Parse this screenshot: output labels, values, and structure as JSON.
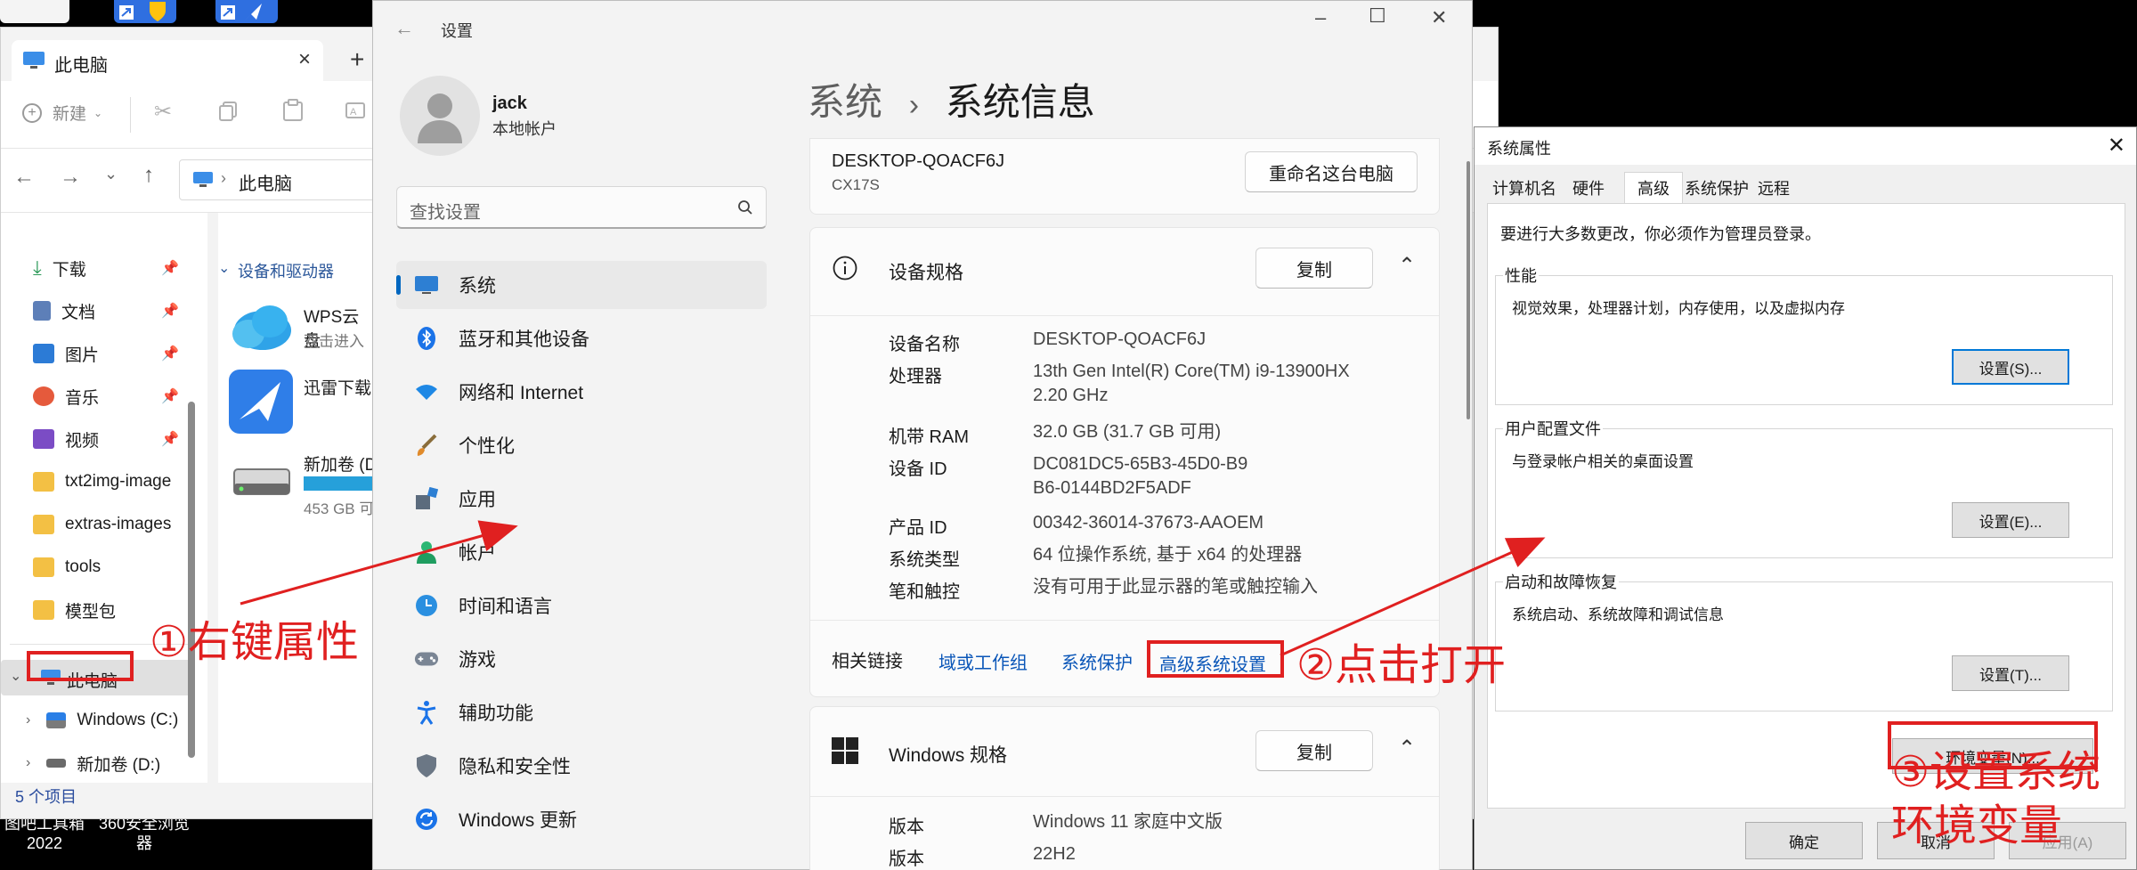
{
  "explorer": {
    "tab_title": "此电脑",
    "toolbar_new": "新建",
    "address": "此电脑",
    "quick_access": [
      "下载",
      "文档",
      "图片",
      "音乐",
      "视频"
    ],
    "folders": [
      "txt2img-image",
      "extras-images",
      "tools",
      "模型包"
    ],
    "this_pc": "此电脑",
    "drives": [
      "Windows (C:)",
      "新加卷 (D:)"
    ],
    "group_header": "设备和驱动器",
    "items": [
      {
        "title": "WPS云盘",
        "sub": "双击进入"
      },
      {
        "title": "迅雷下载",
        "sub": ""
      },
      {
        "title": "新加卷 (D",
        "sub": "453 GB 可"
      }
    ],
    "status": "5 个项目"
  },
  "taskbar": {
    "labels": [
      "图吧工具箱\n2022",
      "360安全浏览\n器"
    ]
  },
  "settings": {
    "window_title": "设置",
    "user_name": "jack",
    "user_type": "本地帐户",
    "search_placeholder": "查找设置",
    "menu": [
      "系统",
      "蓝牙和其他设备",
      "网络和 Internet",
      "个性化",
      "应用",
      "帐户",
      "时间和语言",
      "游戏",
      "辅助功能",
      "隐私和安全性",
      "Windows 更新"
    ],
    "breadcrumb_parent": "系统",
    "breadcrumb_sep": "›",
    "page_title": "系统信息",
    "device_name_header": "DESKTOP-QOACF6J",
    "device_model": "CX17S",
    "rename_button": "重命名这台电脑",
    "device_spec_title": "设备规格",
    "copy_label": "复制",
    "specs": [
      {
        "key": "设备名称",
        "value": "DESKTOP-QOACF6J"
      },
      {
        "key": "处理器",
        "value": "13th Gen Intel(R) Core(TM) i9-13900HX 2.20 GHz"
      },
      {
        "key": "机带 RAM",
        "value": "32.0 GB (31.7 GB 可用)"
      },
      {
        "key": "设备 ID",
        "value": "DC081DC5-65B3-45D0-B9B6-0144BD2F5ADF"
      },
      {
        "key": "产品 ID",
        "value": "00342-36014-37673-AAOEM"
      },
      {
        "key": "系统类型",
        "value": "64 位操作系统, 基于 x64 的处理器"
      },
      {
        "key": "笔和触控",
        "value": "没有可用于此显示器的笔或触控输入"
      }
    ],
    "related_links_label": "相关链接",
    "related_links": [
      "域或工作组",
      "系统保护",
      "高级系统设置"
    ],
    "windows_spec_title": "Windows 规格",
    "win_specs": [
      {
        "key": "版本",
        "value": "Windows 11 家庭中文版"
      },
      {
        "key": "版本",
        "value": "22H2"
      }
    ]
  },
  "sysprop": {
    "title": "系统属性",
    "tabs": [
      "计算机名",
      "硬件",
      "高级",
      "系统保护",
      "远程"
    ],
    "admin_note": "要进行大多数更改，你必须作为管理员登录。",
    "groups": [
      {
        "legend": "性能",
        "desc": "视觉效果，处理器计划，内存使用，以及虚拟内存",
        "button": "设置(S)..."
      },
      {
        "legend": "用户配置文件",
        "desc": "与登录帐户相关的桌面设置",
        "button": "设置(E)..."
      },
      {
        "legend": "启动和故障恢复",
        "desc": "系统启动、系统故障和调试信息",
        "button": "设置(T)..."
      }
    ],
    "env_button": "环境变量(N)...",
    "ok": "确定",
    "cancel": "取消",
    "apply": "应用(A)"
  },
  "annotations": {
    "step1": "①右键属性",
    "step2": "②点击打开",
    "step3_line1": "③设置系统",
    "step3_line2": "环境变量",
    "color": "#e02020"
  }
}
